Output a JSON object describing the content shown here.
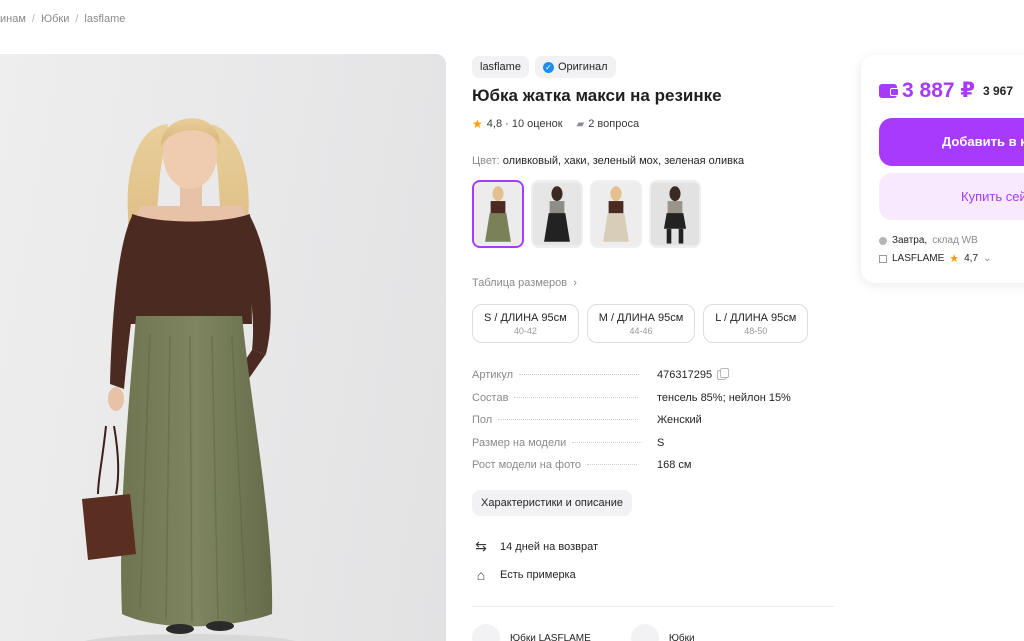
{
  "breadcrumb": [
    "инам",
    "Юбки",
    "lasflame"
  ],
  "product": {
    "brand": "lasflame",
    "original_label": "Оригинал",
    "title": "Юбка жатка макси на резинке",
    "rating": "4,8 · 10 оценок",
    "questions": "2 вопроса",
    "color_label": "Цвет:",
    "color_value": "оливковый, хаки, зеленый мох, зеленая оливка",
    "size_table_label": "Таблица размеров",
    "sizes": [
      {
        "name": "S / ДЛИНА 95см",
        "range": "40-42"
      },
      {
        "name": "M / ДЛИНА 95см",
        "range": "44-46"
      },
      {
        "name": "L / ДЛИНА 95см",
        "range": "48-50"
      }
    ],
    "specs": [
      {
        "key": "Артикул",
        "value": "476317295"
      },
      {
        "key": "Состав",
        "value": "тенсель 85%; нейлон 15%"
      },
      {
        "key": "Пол",
        "value": "Женский"
      },
      {
        "key": "Размер на модели",
        "value": "S"
      },
      {
        "key": "Рост модели на фото",
        "value": "168 см"
      }
    ],
    "characteristics_button": "Характеристики и описание",
    "return_text": "14 дней на возврат",
    "fitting_text": "Есть примерка",
    "bottom_links": [
      "Юбки LASFLAME",
      "Юбки"
    ]
  },
  "buy_card": {
    "price": "3 887 ₽",
    "old_price": "3 967",
    "add_button": "Добавить в корзину",
    "buy_button": "Купить сейчас",
    "delivery_day": "Завтра,",
    "delivery_place": "склад WB",
    "seller": "LASFLAME",
    "seller_rating": "4,7"
  },
  "colors": {
    "accent": "#a73afd",
    "accent_light": "#f8e9ff",
    "star": "#ff9b06",
    "check": "#1f8ef1"
  }
}
